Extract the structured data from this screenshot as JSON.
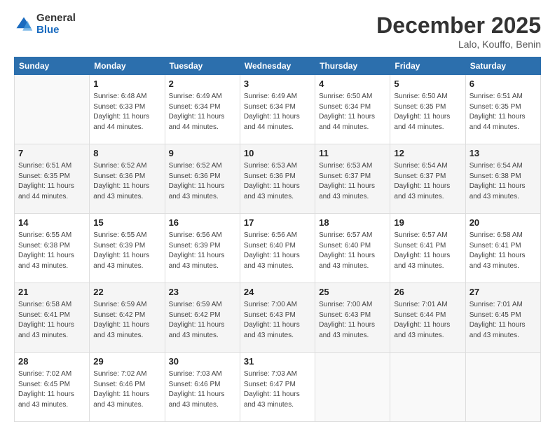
{
  "logo": {
    "general": "General",
    "blue": "Blue"
  },
  "header": {
    "month": "December 2025",
    "location": "Lalo, Kouffo, Benin"
  },
  "days_of_week": [
    "Sunday",
    "Monday",
    "Tuesday",
    "Wednesday",
    "Thursday",
    "Friday",
    "Saturday"
  ],
  "weeks": [
    [
      {
        "day": "",
        "info": ""
      },
      {
        "day": "1",
        "info": "Sunrise: 6:48 AM\nSunset: 6:33 PM\nDaylight: 11 hours\nand 44 minutes."
      },
      {
        "day": "2",
        "info": "Sunrise: 6:49 AM\nSunset: 6:34 PM\nDaylight: 11 hours\nand 44 minutes."
      },
      {
        "day": "3",
        "info": "Sunrise: 6:49 AM\nSunset: 6:34 PM\nDaylight: 11 hours\nand 44 minutes."
      },
      {
        "day": "4",
        "info": "Sunrise: 6:50 AM\nSunset: 6:34 PM\nDaylight: 11 hours\nand 44 minutes."
      },
      {
        "day": "5",
        "info": "Sunrise: 6:50 AM\nSunset: 6:35 PM\nDaylight: 11 hours\nand 44 minutes."
      },
      {
        "day": "6",
        "info": "Sunrise: 6:51 AM\nSunset: 6:35 PM\nDaylight: 11 hours\nand 44 minutes."
      }
    ],
    [
      {
        "day": "7",
        "info": "Sunrise: 6:51 AM\nSunset: 6:35 PM\nDaylight: 11 hours\nand 44 minutes."
      },
      {
        "day": "8",
        "info": "Sunrise: 6:52 AM\nSunset: 6:36 PM\nDaylight: 11 hours\nand 43 minutes."
      },
      {
        "day": "9",
        "info": "Sunrise: 6:52 AM\nSunset: 6:36 PM\nDaylight: 11 hours\nand 43 minutes."
      },
      {
        "day": "10",
        "info": "Sunrise: 6:53 AM\nSunset: 6:36 PM\nDaylight: 11 hours\nand 43 minutes."
      },
      {
        "day": "11",
        "info": "Sunrise: 6:53 AM\nSunset: 6:37 PM\nDaylight: 11 hours\nand 43 minutes."
      },
      {
        "day": "12",
        "info": "Sunrise: 6:54 AM\nSunset: 6:37 PM\nDaylight: 11 hours\nand 43 minutes."
      },
      {
        "day": "13",
        "info": "Sunrise: 6:54 AM\nSunset: 6:38 PM\nDaylight: 11 hours\nand 43 minutes."
      }
    ],
    [
      {
        "day": "14",
        "info": "Sunrise: 6:55 AM\nSunset: 6:38 PM\nDaylight: 11 hours\nand 43 minutes."
      },
      {
        "day": "15",
        "info": "Sunrise: 6:55 AM\nSunset: 6:39 PM\nDaylight: 11 hours\nand 43 minutes."
      },
      {
        "day": "16",
        "info": "Sunrise: 6:56 AM\nSunset: 6:39 PM\nDaylight: 11 hours\nand 43 minutes."
      },
      {
        "day": "17",
        "info": "Sunrise: 6:56 AM\nSunset: 6:40 PM\nDaylight: 11 hours\nand 43 minutes."
      },
      {
        "day": "18",
        "info": "Sunrise: 6:57 AM\nSunset: 6:40 PM\nDaylight: 11 hours\nand 43 minutes."
      },
      {
        "day": "19",
        "info": "Sunrise: 6:57 AM\nSunset: 6:41 PM\nDaylight: 11 hours\nand 43 minutes."
      },
      {
        "day": "20",
        "info": "Sunrise: 6:58 AM\nSunset: 6:41 PM\nDaylight: 11 hours\nand 43 minutes."
      }
    ],
    [
      {
        "day": "21",
        "info": "Sunrise: 6:58 AM\nSunset: 6:41 PM\nDaylight: 11 hours\nand 43 minutes."
      },
      {
        "day": "22",
        "info": "Sunrise: 6:59 AM\nSunset: 6:42 PM\nDaylight: 11 hours\nand 43 minutes."
      },
      {
        "day": "23",
        "info": "Sunrise: 6:59 AM\nSunset: 6:42 PM\nDaylight: 11 hours\nand 43 minutes."
      },
      {
        "day": "24",
        "info": "Sunrise: 7:00 AM\nSunset: 6:43 PM\nDaylight: 11 hours\nand 43 minutes."
      },
      {
        "day": "25",
        "info": "Sunrise: 7:00 AM\nSunset: 6:43 PM\nDaylight: 11 hours\nand 43 minutes."
      },
      {
        "day": "26",
        "info": "Sunrise: 7:01 AM\nSunset: 6:44 PM\nDaylight: 11 hours\nand 43 minutes."
      },
      {
        "day": "27",
        "info": "Sunrise: 7:01 AM\nSunset: 6:45 PM\nDaylight: 11 hours\nand 43 minutes."
      }
    ],
    [
      {
        "day": "28",
        "info": "Sunrise: 7:02 AM\nSunset: 6:45 PM\nDaylight: 11 hours\nand 43 minutes."
      },
      {
        "day": "29",
        "info": "Sunrise: 7:02 AM\nSunset: 6:46 PM\nDaylight: 11 hours\nand 43 minutes."
      },
      {
        "day": "30",
        "info": "Sunrise: 7:03 AM\nSunset: 6:46 PM\nDaylight: 11 hours\nand 43 minutes."
      },
      {
        "day": "31",
        "info": "Sunrise: 7:03 AM\nSunset: 6:47 PM\nDaylight: 11 hours\nand 43 minutes."
      },
      {
        "day": "",
        "info": ""
      },
      {
        "day": "",
        "info": ""
      },
      {
        "day": "",
        "info": ""
      }
    ]
  ]
}
